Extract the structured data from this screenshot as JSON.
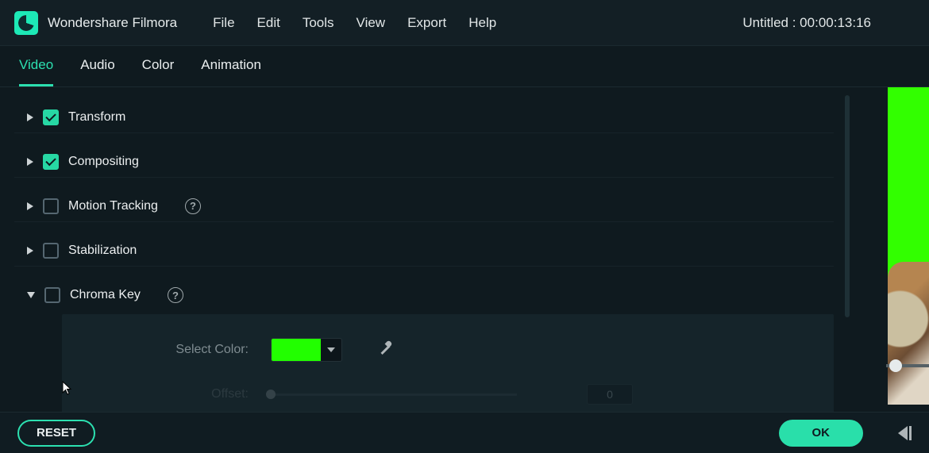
{
  "app": {
    "title": "Wondershare Filmora"
  },
  "menu": {
    "file": "File",
    "edit": "Edit",
    "tools": "Tools",
    "view": "View",
    "export": "Export",
    "help": "Help"
  },
  "project_readout": "Untitled : 00:00:13:16",
  "tabs": {
    "video": "Video",
    "audio": "Audio",
    "color": "Color",
    "animation": "Animation"
  },
  "sections": {
    "transform": {
      "label": "Transform"
    },
    "compositing": {
      "label": "Compositing"
    },
    "motion_tracking": {
      "label": "Motion Tracking"
    },
    "stabilization": {
      "label": "Stabilization"
    },
    "chroma_key": {
      "label": "Chroma Key"
    }
  },
  "chroma": {
    "select_color_label": "Select Color:",
    "color_hex": "#22ff00",
    "offset_label": "Offset:",
    "offset_value": "0"
  },
  "buttons": {
    "reset": "RESET",
    "ok": "OK"
  },
  "icons": {
    "help": "?",
    "eyedropper": "eyedropper-icon",
    "chevron_down": "chevron-down-icon",
    "frame_step_back": "frame-step-back-icon"
  }
}
